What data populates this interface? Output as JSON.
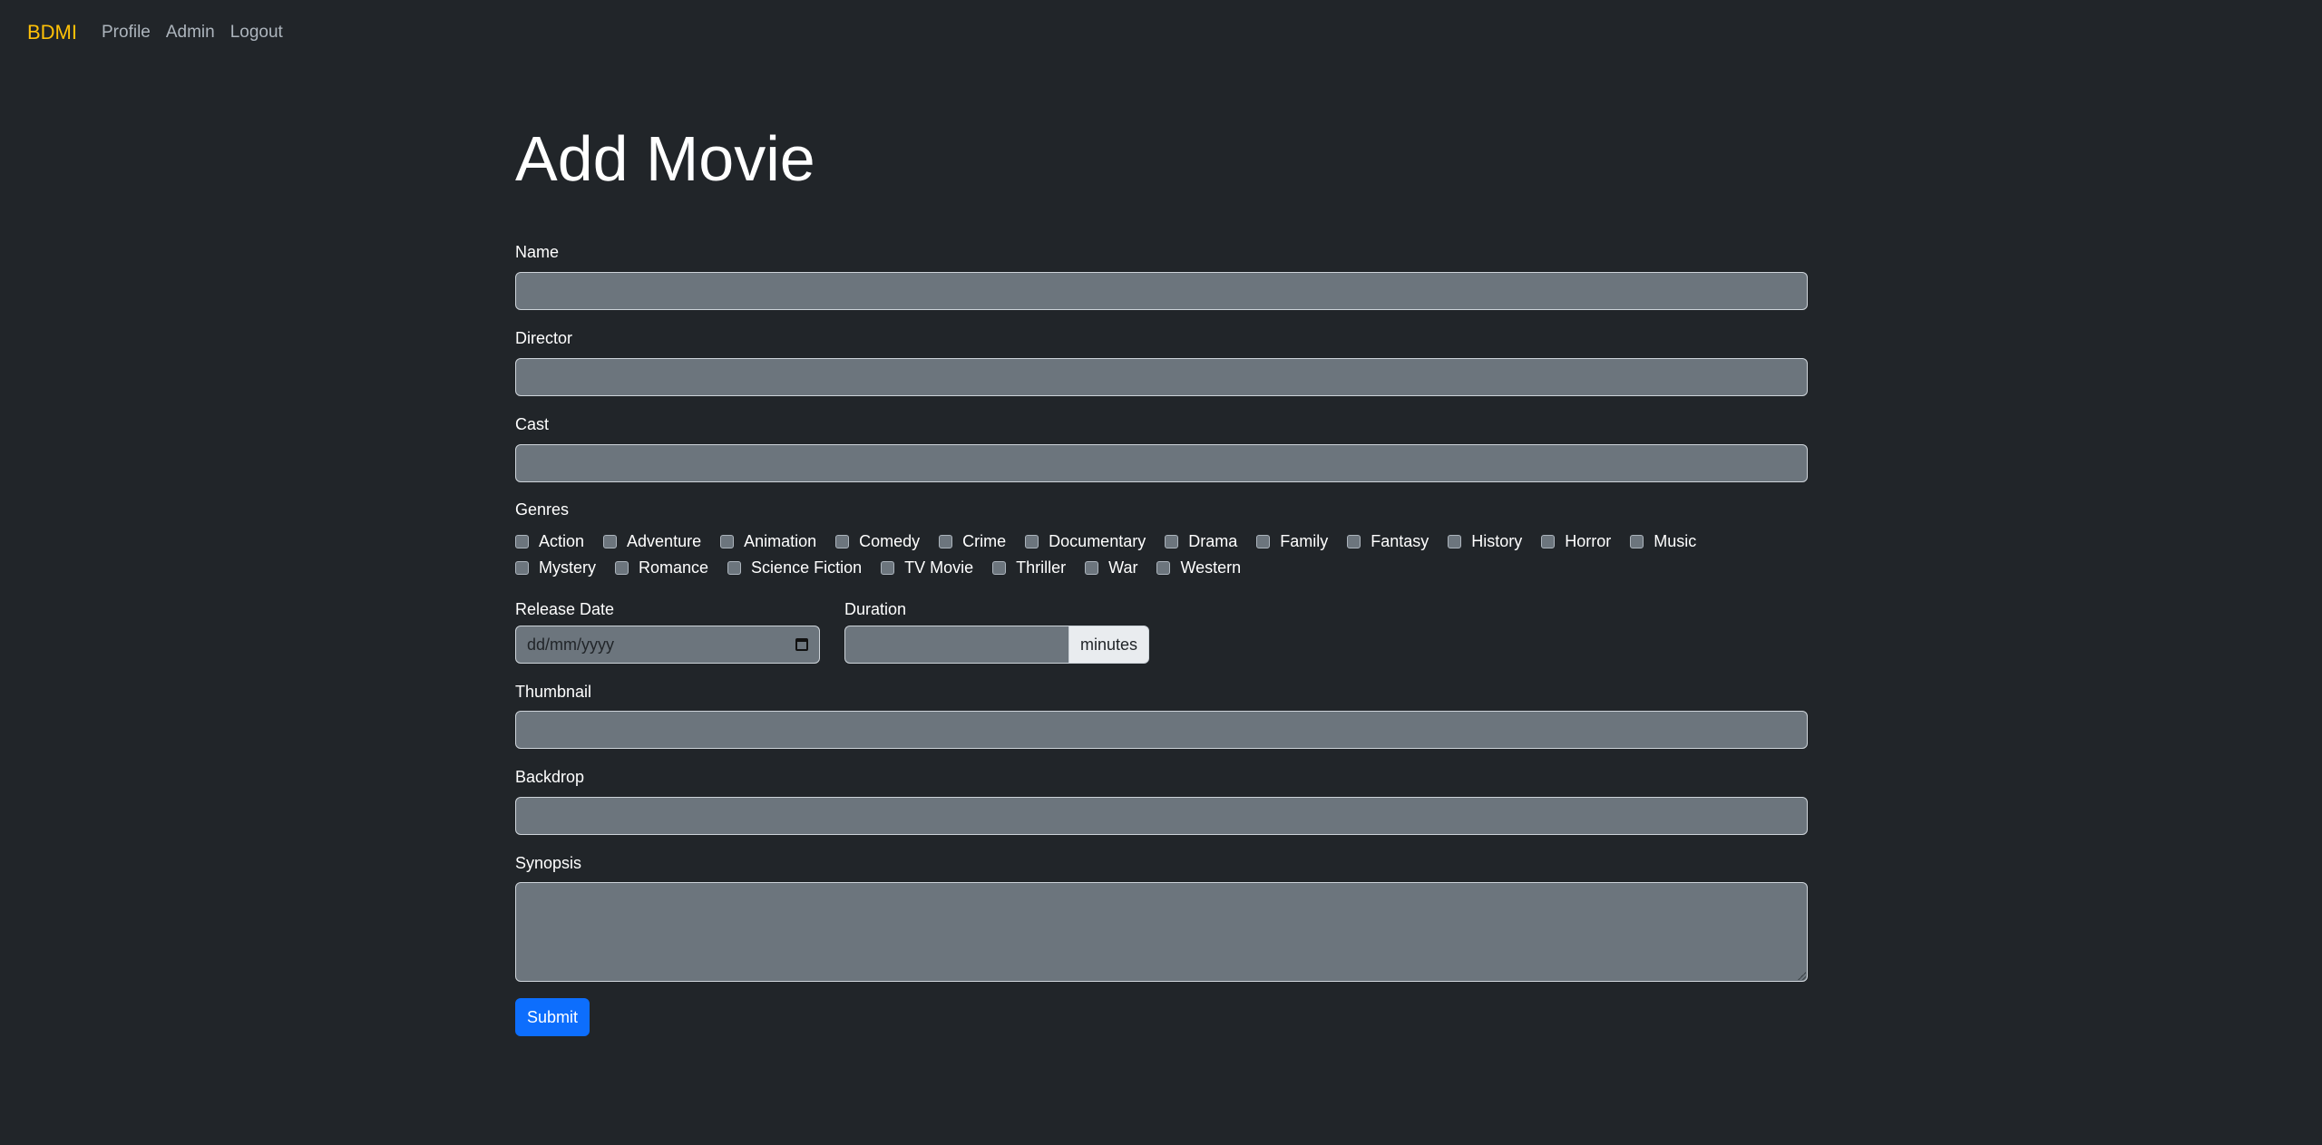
{
  "nav": {
    "brand": "BDMI",
    "links": [
      "Profile",
      "Admin",
      "Logout"
    ]
  },
  "page": {
    "title": "Add Movie"
  },
  "form": {
    "name": {
      "label": "Name",
      "value": ""
    },
    "director": {
      "label": "Director",
      "value": ""
    },
    "cast": {
      "label": "Cast",
      "value": ""
    },
    "genres": {
      "label": "Genres",
      "row1": [
        "Action",
        "Adventure",
        "Animation",
        "Comedy",
        "Crime",
        "Documentary",
        "Drama",
        "Family",
        "Fantasy",
        "History",
        "Horror",
        "Music"
      ],
      "row2": [
        "Mystery",
        "Romance",
        "Science Fiction",
        "TV Movie",
        "Thriller",
        "War",
        "Western"
      ],
      "checked": []
    },
    "release_date": {
      "label": "Release Date",
      "placeholder": "dd/mm/yyyy"
    },
    "duration": {
      "label": "Duration",
      "addon": "minutes",
      "value": ""
    },
    "thumbnail": {
      "label": "Thumbnail",
      "value": ""
    },
    "backdrop": {
      "label": "Backdrop",
      "value": ""
    },
    "synopsis": {
      "label": "Synopsis",
      "value": ""
    },
    "submit_label": "Submit"
  },
  "colors": {
    "background": "#212529",
    "brand": "#ffc107",
    "input_bg": "#6c757d",
    "primary": "#0d6efd"
  }
}
